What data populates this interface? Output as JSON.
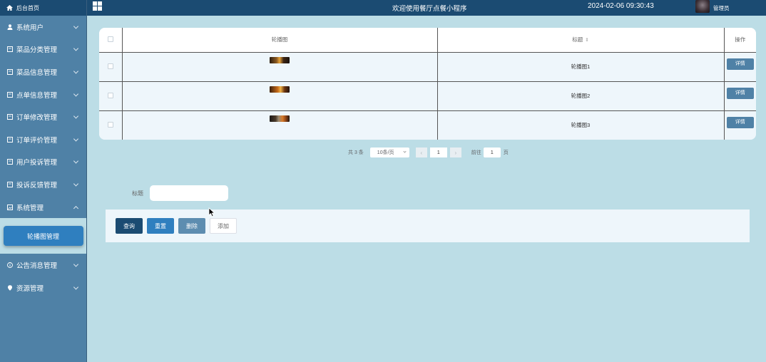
{
  "sidebar": {
    "home_label": "后台首页",
    "items": [
      {
        "label": "系统用户",
        "icon": "user-icon"
      },
      {
        "label": "菜品分类管理",
        "icon": "doc-icon"
      },
      {
        "label": "菜品信息管理",
        "icon": "doc-icon"
      },
      {
        "label": "点单信息管理",
        "icon": "doc-icon"
      },
      {
        "label": "订单修改管理",
        "icon": "doc-icon"
      },
      {
        "label": "订单评价管理",
        "icon": "doc-icon"
      },
      {
        "label": "用户投诉管理",
        "icon": "doc-icon"
      },
      {
        "label": "投诉反馈管理",
        "icon": "doc-icon"
      },
      {
        "label": "系统管理",
        "icon": "image-icon"
      }
    ],
    "sub_active": "轮播图管理",
    "items_after": [
      {
        "label": "公告消息管理",
        "icon": "info-icon"
      },
      {
        "label": "资源管理",
        "icon": "location-icon"
      }
    ]
  },
  "header": {
    "title": "欢迎使用餐厅点餐小程序",
    "datetime": "2024-02-06 09:30:43",
    "user": "管理员"
  },
  "table": {
    "columns": [
      "轮播图",
      "标题",
      "操作"
    ],
    "rows": [
      {
        "title": "轮播图1",
        "action": "详情"
      },
      {
        "title": "轮播图2",
        "action": "详情"
      },
      {
        "title": "轮播图3",
        "action": "详情"
      }
    ]
  },
  "pagination": {
    "total": "共 3 条",
    "page_size": "10条/页",
    "current": "1",
    "goto_prefix": "前往",
    "goto_value": "1",
    "goto_suffix": "页"
  },
  "search": {
    "label": "标题"
  },
  "actions": {
    "query": "查询",
    "reset": "重置",
    "delete": "删除",
    "add": "添加"
  },
  "colors": {
    "header_bg": "#1b4b72",
    "sidebar_bg": "#4f81a6",
    "page_bg": "#bcdde6",
    "accent": "#2f7fbf"
  }
}
